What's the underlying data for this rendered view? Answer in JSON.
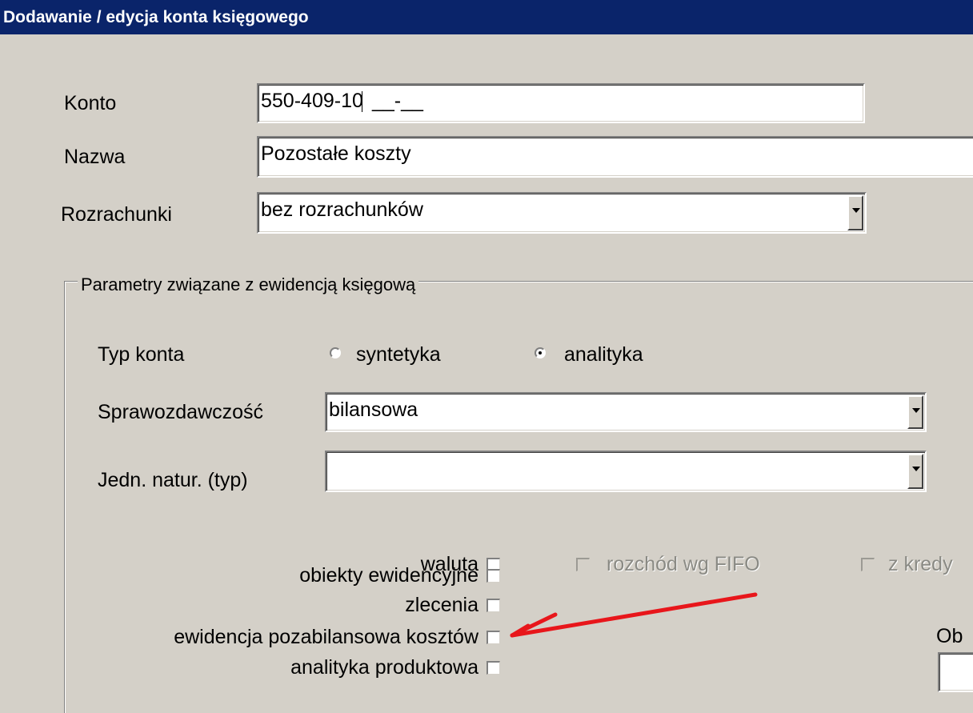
{
  "window": {
    "title": "Dodawanie / edycja konta księgowego"
  },
  "form": {
    "konto": {
      "label": "Konto",
      "value": "550-409-10",
      "mask": "__-__"
    },
    "nazwa": {
      "label": "Nazwa",
      "value": "Pozostałe koszty"
    },
    "rozrachunki": {
      "label": "Rozrachunki",
      "value": "bez rozrachunków"
    }
  },
  "group": {
    "legend": "Parametry związane z ewidencją księgową",
    "typ_konta": {
      "label": "Typ konta",
      "options": [
        {
          "label": "syntetyka",
          "checked": false
        },
        {
          "label": "analityka",
          "checked": true
        }
      ]
    },
    "sprawozdawczosc": {
      "label": "Sprawozdawczość",
      "value": "bilansowa"
    },
    "jedn_natur": {
      "label": "Jedn. natur. (typ)",
      "value": ""
    },
    "checkboxes": [
      {
        "label": "waluta",
        "checked": false
      },
      {
        "label": "obiekty ewidencyjne",
        "checked": false
      },
      {
        "label": "zlecenia",
        "checked": false
      },
      {
        "label": "ewidencja pozabilansowa kosztów",
        "checked": false
      },
      {
        "label": "analityka produktowa",
        "checked": false
      }
    ],
    "disabled_checkboxes": [
      {
        "label": "rozchód wg FIFO",
        "checked": false
      },
      {
        "label": "z kredy",
        "checked": false
      }
    ],
    "partial_label": "Ob"
  },
  "annotation": {
    "arrow_color": "#e8161b"
  }
}
